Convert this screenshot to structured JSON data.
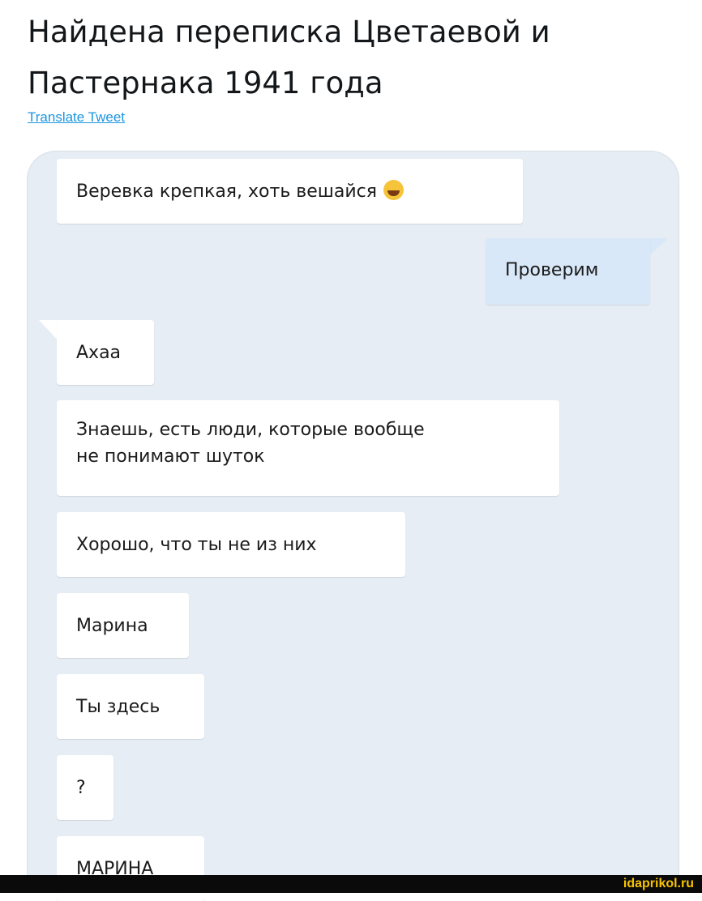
{
  "tweet": {
    "text": "Найдена переписка Цветаевой и Пастернака 1941 года",
    "translate_link": "Translate Tweet"
  },
  "messages": [
    {
      "text": "Веревка крепкая, хоть вешайся",
      "side": "incoming",
      "emoji": "grinning-face-emoji"
    },
    {
      "text": "Проверим",
      "side": "outgoing"
    },
    {
      "text": "Ахаа",
      "side": "incoming"
    },
    {
      "text": "Знаешь, есть люди, которые вообще",
      "text2": "не понимают шуток",
      "side": "incoming"
    },
    {
      "text": "Хорошо, что ты не из них",
      "side": "incoming"
    },
    {
      "text": "Марина",
      "side": "incoming"
    },
    {
      "text": "Ты здесь",
      "side": "incoming"
    },
    {
      "text": "?",
      "side": "incoming"
    },
    {
      "text": "МАРИНА",
      "side": "incoming"
    }
  ],
  "watermark": "idaprikol.ru",
  "colors": {
    "chat_background": "#e6edf4",
    "incoming_bubble": "#ffffff",
    "outgoing_bubble": "#d9e8f8",
    "link": "#1b95e0",
    "watermark": "#f7c300"
  }
}
